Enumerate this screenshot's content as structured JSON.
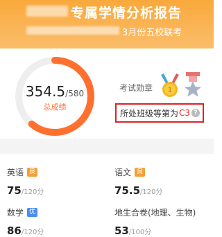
{
  "header": {
    "title": "专属学情分析报告",
    "subtitle": "3月份五校联考"
  },
  "summary": {
    "score": "354.5",
    "total": "/580",
    "score_label": "总成绩",
    "score_ratio": 0.61,
    "medal_label": "考试勋章",
    "rank_text": "所处班级等第为",
    "rank_value": "C3",
    "help_symbol": "?"
  },
  "subjects": [
    {
      "name": "英语",
      "badge": "良",
      "score": "75",
      "total": "/120分"
    },
    {
      "name": "语文",
      "badge": "良",
      "score": "75.5",
      "total": "/120分"
    },
    {
      "name": "数学",
      "badge": "优",
      "score": "86",
      "total": "/120分"
    },
    {
      "name": "地生合卷(地理、生物)",
      "score": "53",
      "total": "/100分"
    }
  ],
  "colors": {
    "header_bg": "#f9a93c",
    "ring_progress": "#ff6f2e",
    "ring_track": "#eeeeee",
    "badge_good": "#f5a035",
    "badge_excellent": "#4a8cf0",
    "rank_highlight": "#e02222"
  },
  "icons": {
    "gold_medal": "gold-medal-icon",
    "silver_medal": "silver-star-medal-icon",
    "help": "question-circle-icon"
  }
}
